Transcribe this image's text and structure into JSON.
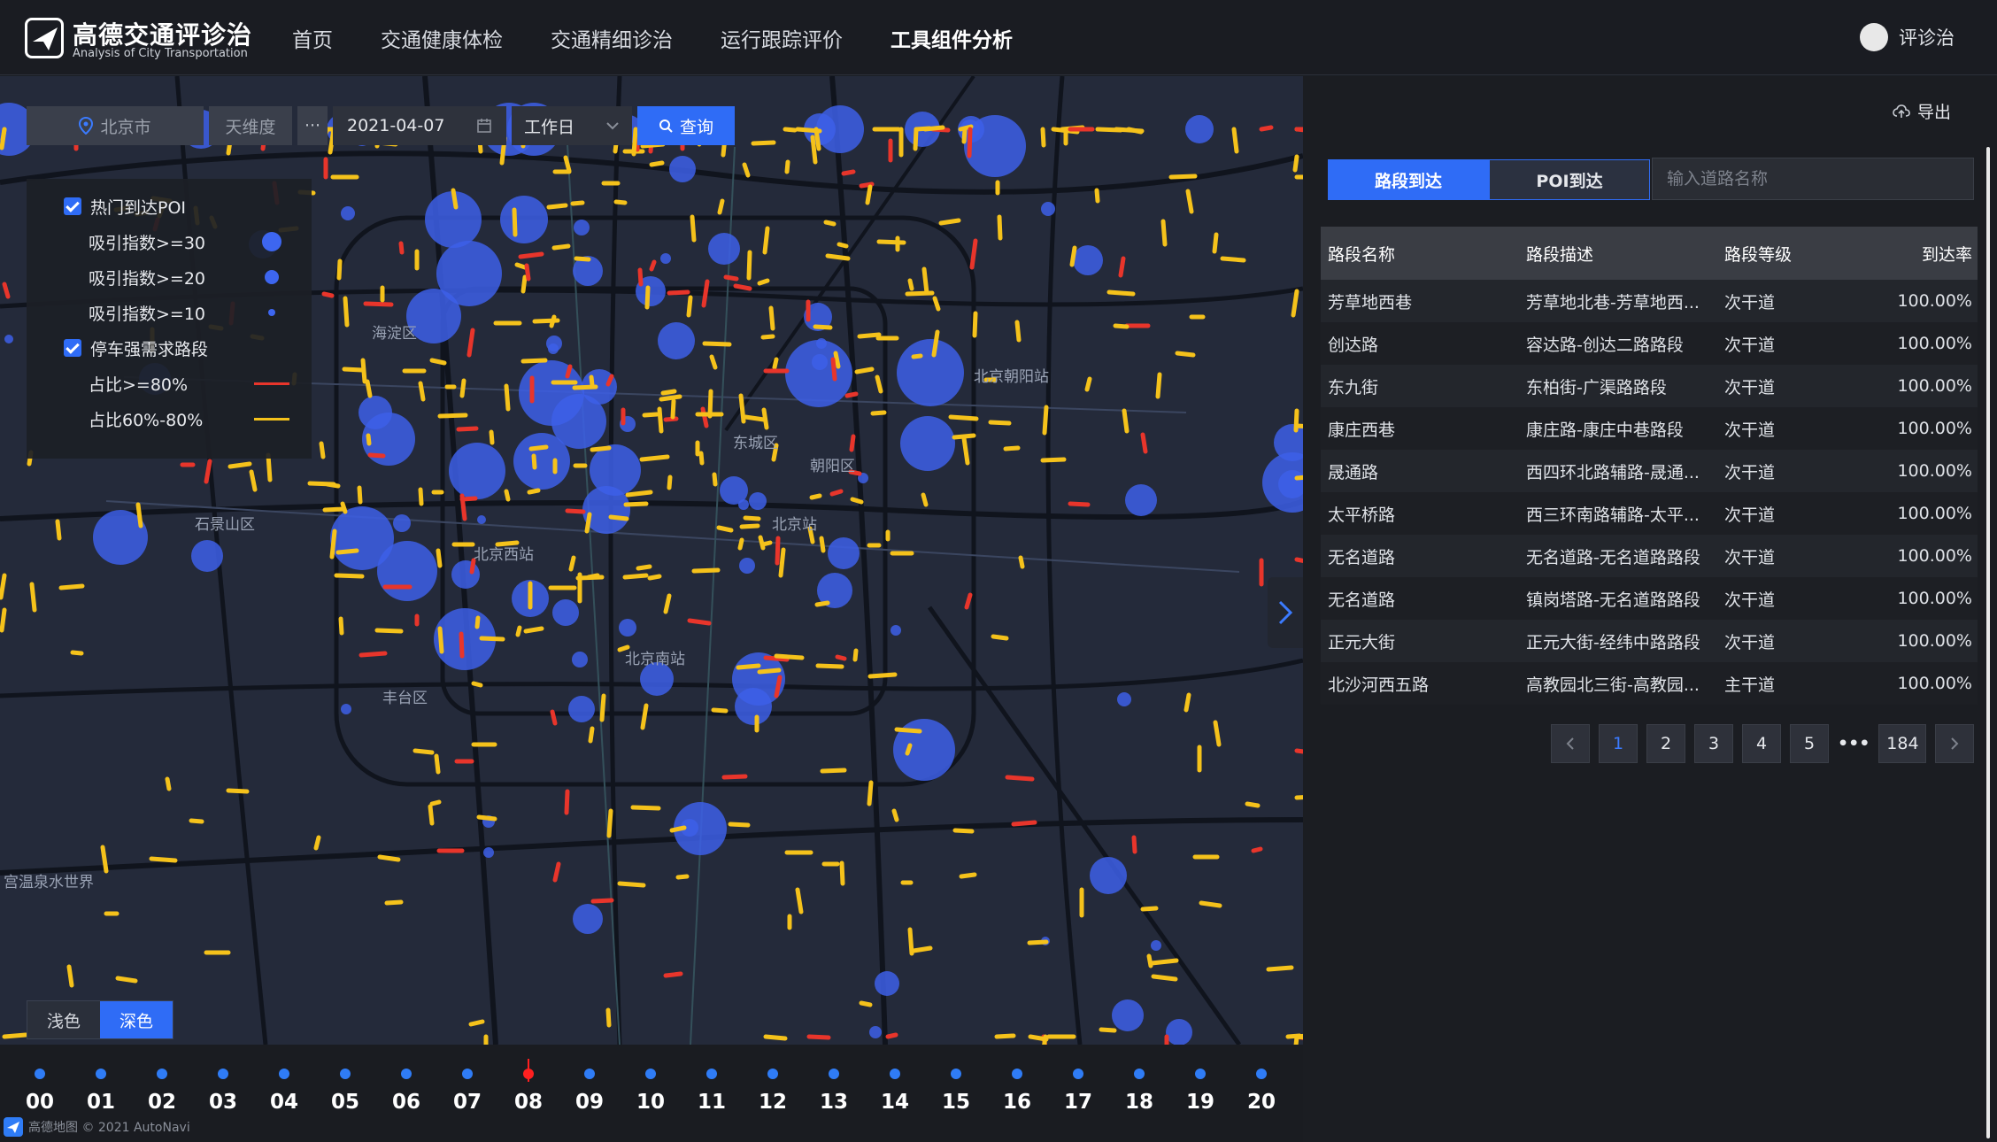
{
  "header": {
    "logo_title": "高德交通评诊治",
    "logo_subtitle": "Analysis of City Transportation",
    "nav": [
      "首页",
      "交通健康体检",
      "交通精细诊治",
      "运行跟踪评价",
      "工具组件分析"
    ],
    "active_nav": "工具组件分析",
    "user_name": "评诊治"
  },
  "toolbar": {
    "city": "北京市",
    "dimension": "天维度",
    "more": "···",
    "date": "2021-04-07",
    "day_type": "工作日",
    "query_label": "查询"
  },
  "legend": {
    "poi_label": "热门到达POI",
    "poi_items": [
      "吸引指数>=30",
      "吸引指数>=20",
      "吸引指数>=10"
    ],
    "road_label": "停车强需求路段",
    "road_items": [
      "占比>=80%",
      "占比60%-80%"
    ],
    "colors": {
      "poi": "#3d66f0",
      "high": "#e8352b",
      "mid": "#f5c21b"
    }
  },
  "map_labels": [
    "海淀区",
    "北京朝阳站",
    "东城区",
    "石景山区",
    "北京西站",
    "朝阳区",
    "北京站",
    "北京南站",
    "丰台区",
    "宫温泉水世界"
  ],
  "theme": {
    "light": "浅色",
    "dark": "深色"
  },
  "timeline": {
    "hours": [
      "00",
      "01",
      "02",
      "03",
      "04",
      "05",
      "06",
      "07",
      "08",
      "09",
      "10",
      "11",
      "12",
      "13",
      "14",
      "15",
      "16",
      "17",
      "18",
      "19",
      "20"
    ],
    "active": "08",
    "attribution": "高德地图 © 2021 AutoNavi"
  },
  "panel": {
    "export_label": "导出",
    "tabs": [
      "路段到达",
      "POI到达"
    ],
    "active_tab": "路段到达",
    "search_placeholder": "输入道路名称",
    "columns": [
      "路段名称",
      "路段描述",
      "路段等级",
      "到达率"
    ],
    "rows": [
      [
        "芳草地西巷",
        "芳草地北巷-芳草地西...",
        "次干道",
        "100.00%"
      ],
      [
        "创达路",
        "容达路-创达二路路段",
        "次干道",
        "100.00%"
      ],
      [
        "东九街",
        "东柏街-广渠路路段",
        "次干道",
        "100.00%"
      ],
      [
        "康庄西巷",
        "康庄路-康庄中巷路段",
        "次干道",
        "100.00%"
      ],
      [
        "晟通路",
        "西四环北路辅路-晟通...",
        "次干道",
        "100.00%"
      ],
      [
        "太平桥路",
        "西三环南路辅路-太平...",
        "次干道",
        "100.00%"
      ],
      [
        "无名道路",
        "无名道路-无名道路路段",
        "次干道",
        "100.00%"
      ],
      [
        "无名道路",
        "镇岗塔路-无名道路路段",
        "次干道",
        "100.00%"
      ],
      [
        "正元大街",
        "正元大街-经纬中路路段",
        "次干道",
        "100.00%"
      ],
      [
        "北沙河西五路",
        "高教园北三街-高教园...",
        "主干道",
        "100.00%"
      ]
    ],
    "pages": [
      "1",
      "2",
      "3",
      "4",
      "5",
      "•••",
      "184"
    ],
    "active_page": "1"
  }
}
